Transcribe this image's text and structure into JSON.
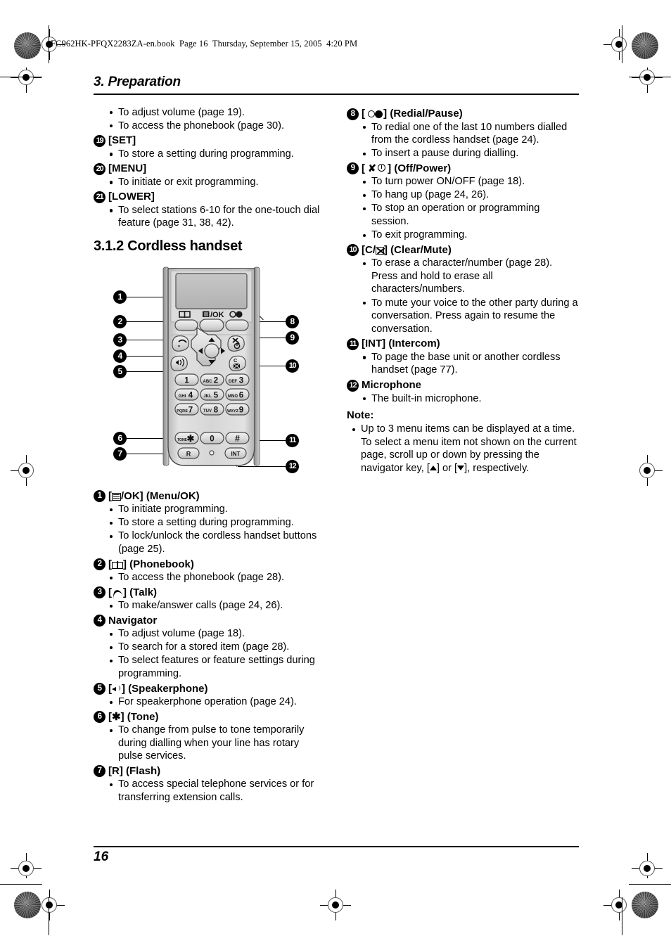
{
  "print_header": "FC962HK-PFQX2283ZA-en.book  Page 16  Thursday, September 15, 2005  4:20 PM",
  "chapter": {
    "title": "3. Preparation"
  },
  "footer": {
    "page_number": "16"
  },
  "section": {
    "title": "3.1.2 Cordless handset"
  },
  "left_column": {
    "leading_bullets": [
      "To adjust volume (page 19).",
      "To access the phonebook (page 30)."
    ],
    "items_top": [
      {
        "num": "19",
        "label": "[SET]",
        "bullets": [
          "To store a setting during programming."
        ]
      },
      {
        "num": "20",
        "label": "[MENU]",
        "bullets": [
          "To initiate or exit programming."
        ]
      },
      {
        "num": "21",
        "label": "[LOWER]",
        "bullets": [
          "To select stations 6-10 for the one-touch dial feature (page 31, 38, 42)."
        ]
      }
    ],
    "items_bottom": [
      {
        "num": "1",
        "label_prefix": "[",
        "icon": "menu-icon",
        "label_suffix": "/OK] (Menu/OK)",
        "bullets": [
          "To initiate programming.",
          "To store a setting during programming.",
          "To lock/unlock the cordless handset buttons (page 25)."
        ]
      },
      {
        "num": "2",
        "label_prefix": "[",
        "icon": "phonebook-icon",
        "label_suffix": "] (Phonebook)",
        "bullets": [
          "To access the phonebook (page 28)."
        ]
      },
      {
        "num": "3",
        "label_prefix": "[",
        "icon": "talk-icon",
        "label_suffix": "] (Talk)",
        "bullets": [
          "To make/answer calls (page 24, 26)."
        ]
      },
      {
        "num": "4",
        "label_prefix": "",
        "icon": "",
        "label_suffix": "Navigator",
        "bullets": [
          "To adjust volume (page 18).",
          "To search for a stored item (page 28).",
          "To select features or feature settings during programming."
        ]
      },
      {
        "num": "5",
        "label_prefix": "[",
        "icon": "speakerphone-icon",
        "label_suffix": "] (Speakerphone)",
        "bullets": [
          "For speakerphone operation (page 24)."
        ]
      },
      {
        "num": "6",
        "label_prefix": "[",
        "icon": "star-icon",
        "label_suffix": "] (Tone)",
        "bullets": [
          "To change from pulse to tone temporarily during dialling when your line has rotary pulse services."
        ]
      },
      {
        "num": "7",
        "label_prefix": "",
        "icon": "",
        "label_suffix": "[R] (Flash)",
        "bullets": [
          "To access special telephone services or for transferring extension calls."
        ]
      }
    ]
  },
  "right_column": {
    "items": [
      {
        "num": "8",
        "label_prefix": "[",
        "icon": "redial-icon",
        "label_suffix": "] (Redial/Pause)",
        "bullets": [
          "To redial one of the last 10 numbers dialled from the cordless handset (page 24).",
          "To insert a pause during dialling."
        ]
      },
      {
        "num": "9",
        "label_prefix": "[",
        "icon": "off-power-icon",
        "label_suffix": "] (Off/Power)",
        "bullets": [
          "To turn power ON/OFF (page 18).",
          "To hang up (page 24, 26).",
          "To stop an operation or programming session.",
          "To exit programming."
        ]
      },
      {
        "num": "10",
        "label_prefix": "[C/",
        "icon": "mute-icon",
        "label_suffix": "] (Clear/Mute)",
        "bullets": [
          "To erase a character/number (page 28). Press and hold to erase all characters/numbers.",
          "To mute your voice to the other party during a conversation. Press again to resume the conversation."
        ]
      },
      {
        "num": "11",
        "label_prefix": "",
        "icon": "",
        "label_suffix": "[INT] (Intercom)",
        "bullets": [
          "To page the base unit or another cordless handset (page 77)."
        ]
      },
      {
        "num": "12",
        "label_prefix": "",
        "icon": "",
        "label_suffix": "Microphone",
        "bullets": [
          "The built-in microphone."
        ]
      }
    ],
    "note": {
      "heading": "Note:",
      "text_before": "Up to 3 menu items can be displayed at a time. To select a menu item not shown on the current page, scroll up or down by pressing the navigator key, [",
      "text_middle": "] or [",
      "text_after": "], respectively."
    }
  },
  "figure": {
    "name": "cordless-handset-diagram",
    "display_label": "",
    "soft_labels": {
      "left": "phonebook-icon",
      "center": "menu-ok-icon",
      "right": "redial-icon"
    },
    "keypad": [
      [
        "1",
        "ABC2",
        "DEF3"
      ],
      [
        "GHI4",
        "JKL5",
        "MNO6"
      ],
      [
        "PQRS7",
        "TUV8",
        "WXYZ9"
      ],
      [
        "∗",
        "0",
        "#"
      ]
    ],
    "bottom_keys": [
      "R",
      "INT"
    ],
    "callouts_left": [
      "1",
      "2",
      "3",
      "4",
      "5",
      "6",
      "7"
    ],
    "callouts_right": [
      "8",
      "9",
      "10",
      "11",
      "12"
    ]
  },
  "colors": {
    "ink": "#000000",
    "paper": "#ffffff",
    "handset_body": "#d9d9d9",
    "handset_display": "#bfbfbf",
    "key_face": "#e8e8e8"
  }
}
